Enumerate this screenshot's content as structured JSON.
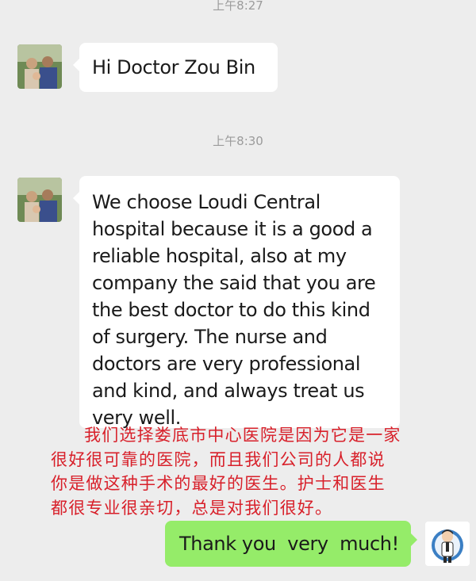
{
  "messages": [
    {
      "timestamp": "上午8:27",
      "text": "Hi Doctor Zou Bin"
    },
    {
      "timestamp": "上午8:30",
      "lines": [
        "We choose Loudi Central",
        "hospital because it is a good a",
        "reliable hospital, also at my",
        "company the said that you are",
        "the best doctor to do this kind",
        "of surgery. The nurse and",
        "doctors are very professional",
        "and kind, and always treat us",
        "very well."
      ]
    },
    {
      "text": "Thank you  very  much!"
    }
  ],
  "translation": {
    "lines": [
      "我们选择娄底市中心医院是因为它是一家",
      "很好很可靠的医院，而且我们公司的人都说",
      "你是做这种手术的最好的医生。护士和医生",
      "都很专业很亲切，总是对我们很好。"
    ]
  },
  "colors": {
    "background": "#ededed",
    "incoming_bubble": "#ffffff",
    "outgoing_bubble": "#95ec69",
    "translation_text": "#d8202a"
  },
  "icons": {
    "contact_avatar": "family-photo-avatar",
    "self_avatar": "doctor-cartoon-avatar"
  }
}
